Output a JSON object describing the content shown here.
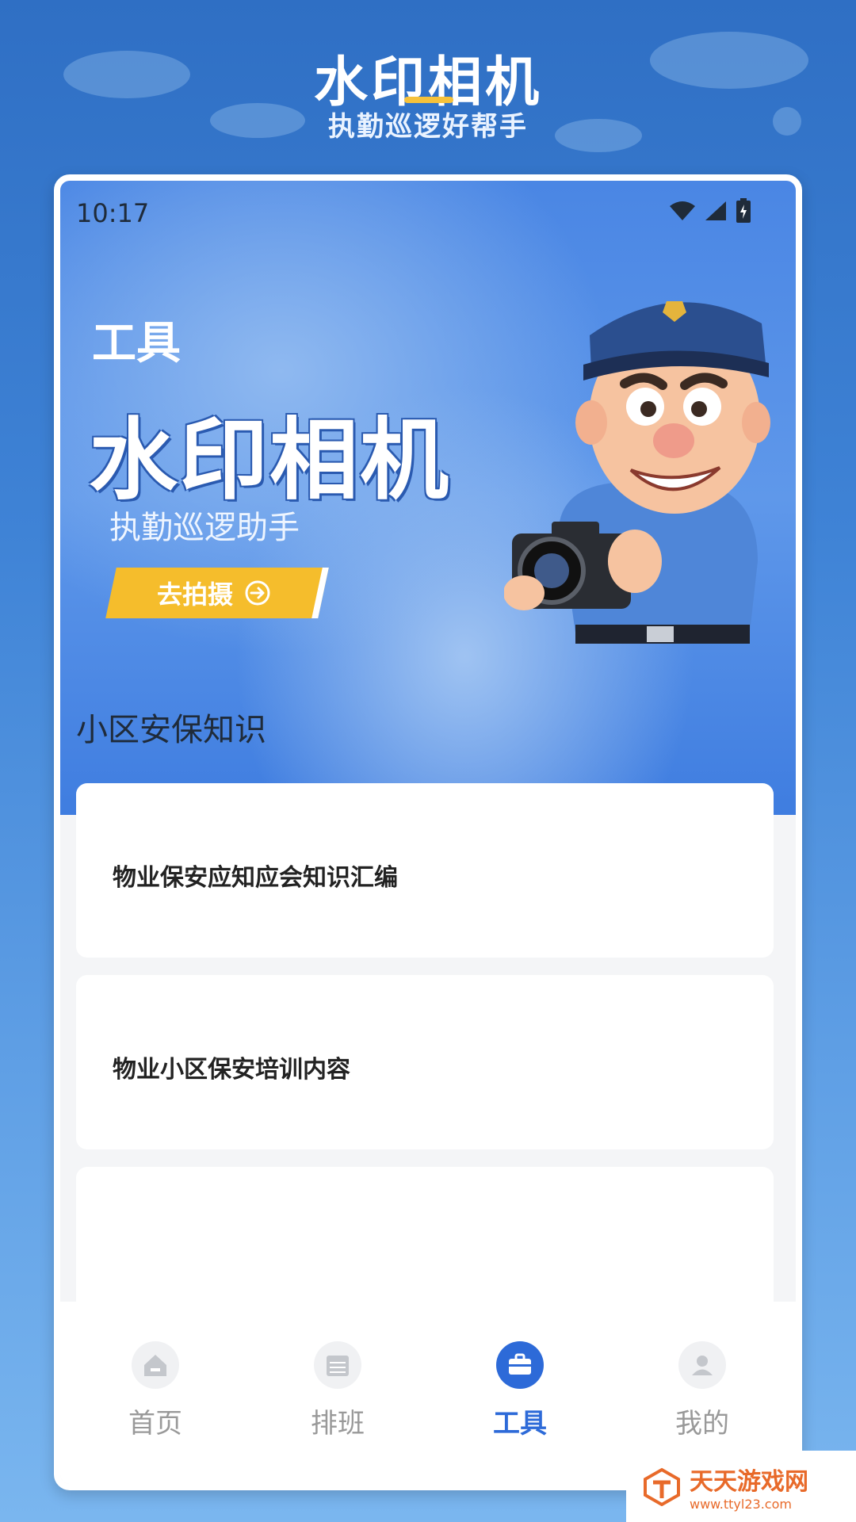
{
  "promo": {
    "title": "水印相机",
    "subtitle": "执勤巡逻好帮手"
  },
  "status_bar": {
    "time": "10:17",
    "icons": [
      "wifi-icon",
      "signal-icon",
      "battery-charging-icon"
    ]
  },
  "hero": {
    "small_title": "工具",
    "big_title": "水印相机",
    "subtitle": "执勤巡逻助手",
    "button_label": "去拍摄",
    "button_icon": "arrow-right-circle-icon",
    "mascot": "police-officer-with-camera-illustration"
  },
  "knowledge": {
    "section_title": "小区安保知识",
    "items": [
      {
        "title": "物业保安应知应会知识汇编"
      },
      {
        "title": "物业小区保安培训内容"
      },
      {
        "title": ""
      }
    ]
  },
  "tabbar": {
    "tabs": [
      {
        "label": "首页",
        "icon": "home-icon",
        "active": false
      },
      {
        "label": "排班",
        "icon": "calendar-icon",
        "active": false
      },
      {
        "label": "工具",
        "icon": "toolbox-icon",
        "active": true
      },
      {
        "label": "我的",
        "icon": "user-icon",
        "active": false
      }
    ]
  },
  "watermark": {
    "name": "天天游戏网",
    "url": "www.ttyl23.com"
  },
  "colors": {
    "accent": "#2d6ad8",
    "button_yellow": "#f5bd2c",
    "inactive": "#999999"
  }
}
